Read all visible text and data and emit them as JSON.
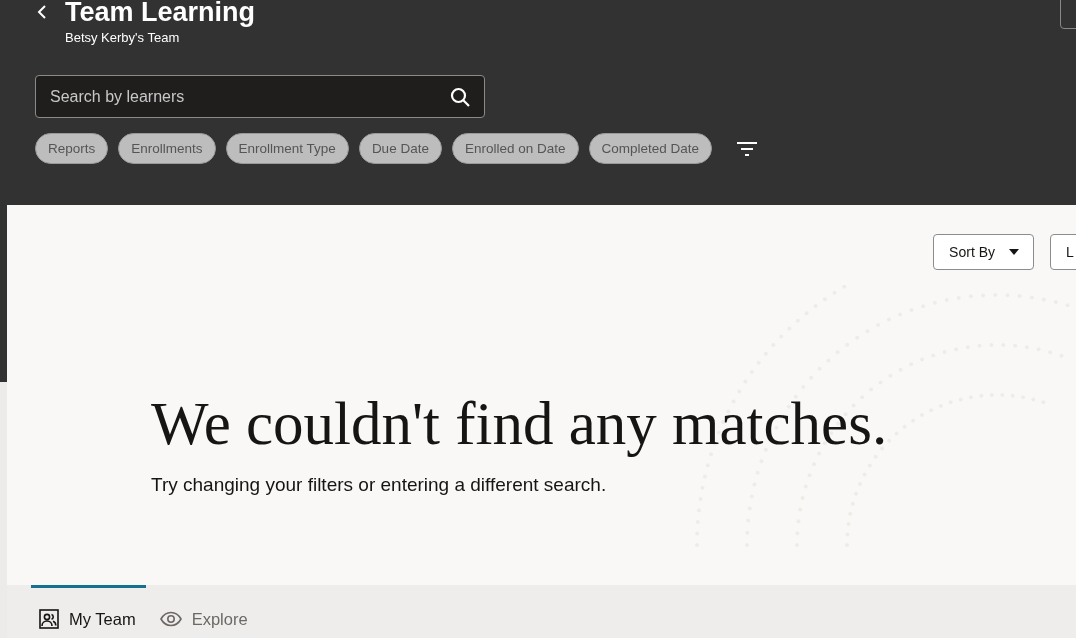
{
  "header": {
    "title": "Team Learning",
    "subtitle": "Betsy Kerby's Team"
  },
  "search": {
    "placeholder": "Search by learners"
  },
  "filters": [
    {
      "label": "Reports"
    },
    {
      "label": "Enrollments"
    },
    {
      "label": "Enrollment Type"
    },
    {
      "label": "Due Date"
    },
    {
      "label": "Enrolled on Date"
    },
    {
      "label": "Completed Date"
    }
  ],
  "toolbar": {
    "sort_button": "Sort By",
    "second_button": "L"
  },
  "empty_state": {
    "heading": "We couldn't find any matches.",
    "message": "Try changing your filters or entering a different search."
  },
  "nav_tabs": [
    {
      "kind": "team",
      "label": "My Team",
      "selected": true
    },
    {
      "kind": "explore",
      "label": "Explore",
      "selected": false
    }
  ]
}
